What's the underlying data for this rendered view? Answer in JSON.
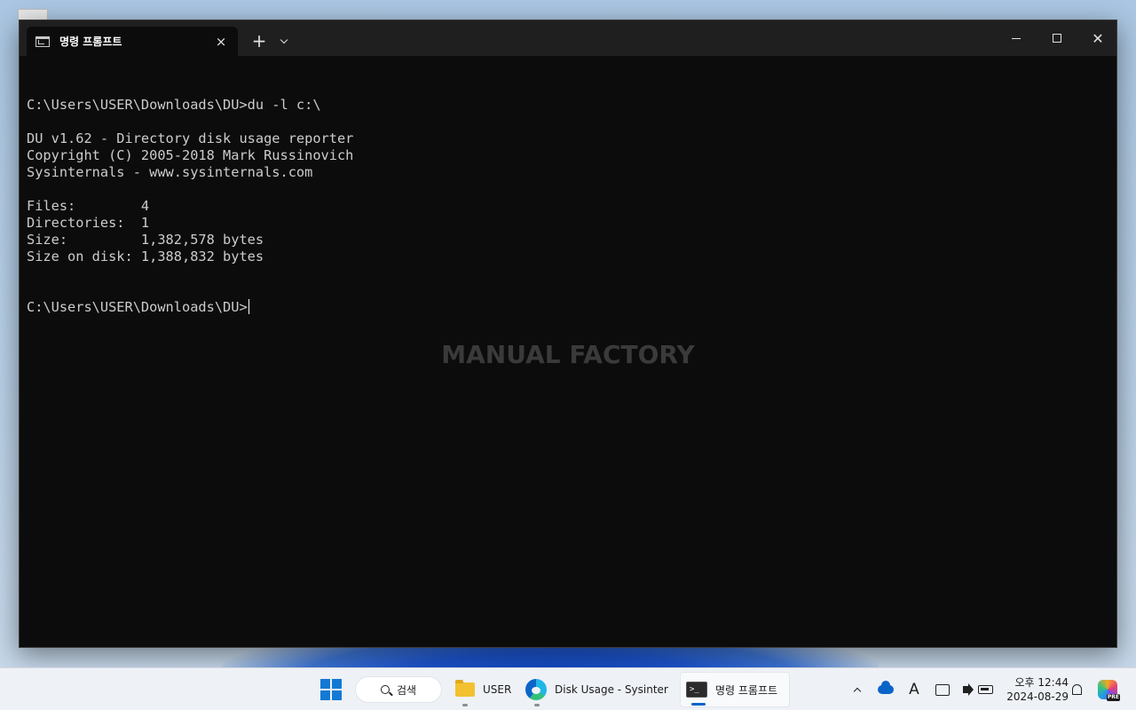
{
  "window": {
    "tab_title": "명령 프롬프트",
    "tab_close_icon": "×",
    "new_tab_icon": "+",
    "close_icon": "✕"
  },
  "console": {
    "lines": [
      "",
      "C:\\Users\\USER\\Downloads\\DU>du -l c:\\",
      "",
      "DU v1.62 - Directory disk usage reporter",
      "Copyright (C) 2005-2018 Mark Russinovich",
      "Sysinternals - www.sysinternals.com",
      "",
      "Files:        4",
      "Directories:  1",
      "Size:         1,382,578 bytes",
      "Size on disk: 1,388,832 bytes",
      "",
      "",
      "C:\\Users\\USER\\Downloads\\DU>"
    ]
  },
  "watermark": "MANUAL FACTORY",
  "taskbar": {
    "search_label": "검색",
    "explorer_label": "USER",
    "edge_label": "Disk Usage - Sysinternals",
    "terminal_label": "명령 프롬프트",
    "ime_indicator": "A",
    "clock_time": "오후 12:44",
    "clock_date": "2024-08-29",
    "copilot_badge": "PRE"
  },
  "colors": {
    "console_bg": "#0c0c0c",
    "console_text": "#cccccc",
    "taskbar_bg": "#eef1f6",
    "accent": "#0a64c8"
  }
}
